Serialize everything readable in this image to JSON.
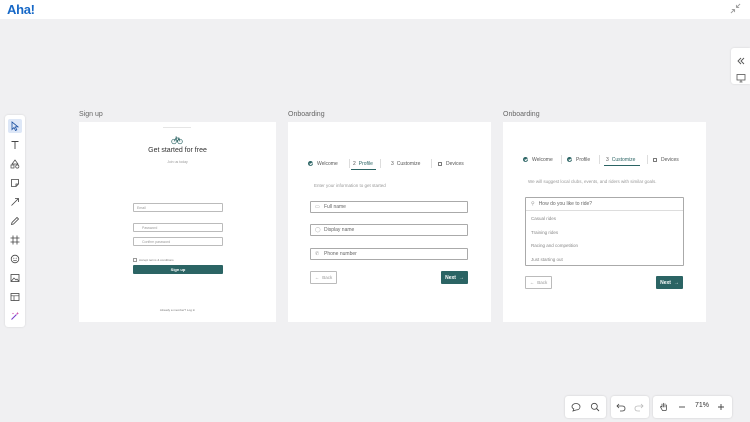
{
  "app": {
    "logo": "Aha!"
  },
  "toolbar": {
    "tools": [
      "pointer-icon",
      "text-icon",
      "shapes-icon",
      "sticky-note-icon",
      "arrow-line-icon",
      "pen-icon",
      "frame-icon",
      "sticker-icon",
      "image-icon",
      "template-icon",
      "ai-magic-icon"
    ],
    "active": "pointer-icon"
  },
  "frames": {
    "signup": {
      "label": "Sign up",
      "title": "Get started for free",
      "subtitle": "Join us today",
      "email_placeholder": "Email",
      "password_placeholder": "Password",
      "confirm_placeholder": "Confirm password",
      "terms": "Accept terms & conditions",
      "button": "Sign up",
      "footer": "Already a member? Log in"
    },
    "onboarding1": {
      "label": "Onboarding",
      "steps": [
        "Welcome",
        "Profile",
        "Customize",
        "Devices"
      ],
      "step_numbers": [
        "2",
        "3"
      ],
      "hint": "Enter your information to get started",
      "fields": [
        "Full name",
        "Display name",
        "Phone number"
      ],
      "back": "Back",
      "next": "Next"
    },
    "onboarding2": {
      "label": "Onboarding",
      "steps": [
        "Welcome",
        "Profile",
        "Customize",
        "Devices"
      ],
      "step_number": "3",
      "hint": "We will suggest local clubs, events, and riders with similar goals.",
      "question": "How do you like to ride?",
      "options": [
        "Casual rides",
        "Training rides",
        "Racing and competition",
        "Just starting out"
      ],
      "back": "Back",
      "next": "Next"
    }
  },
  "bottom": {
    "zoom": "71%"
  },
  "colors": {
    "accent": "#2b6464",
    "logo": "#1668c7"
  }
}
